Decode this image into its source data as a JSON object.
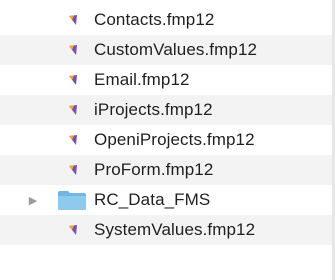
{
  "files": [
    {
      "name": "Contacts.fmp12",
      "type": "file"
    },
    {
      "name": "CustomValues.fmp12",
      "type": "file"
    },
    {
      "name": "Email.fmp12",
      "type": "file"
    },
    {
      "name": "iProjects.fmp12",
      "type": "file"
    },
    {
      "name": "OpeniProjects.fmp12",
      "type": "file"
    },
    {
      "name": "ProForm.fmp12",
      "type": "file"
    },
    {
      "name": "RC_Data_FMS",
      "type": "folder",
      "expanded": false
    },
    {
      "name": "SystemValues.fmp12",
      "type": "file"
    }
  ],
  "icons": {
    "file": "filemaker-file-icon",
    "folder": "folder-icon",
    "disclosure": "disclosure-triangle-icon"
  },
  "colors": {
    "row_alt": "#f3f3f3",
    "folder": "#8ec9ee",
    "filemaker_purple": "#7a4fb5",
    "filemaker_orange": "#f5a623"
  }
}
